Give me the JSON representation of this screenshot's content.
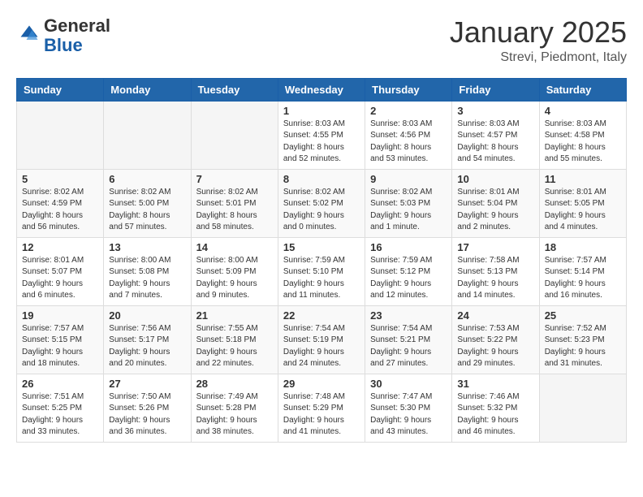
{
  "logo": {
    "general": "General",
    "blue": "Blue"
  },
  "header": {
    "title": "January 2025",
    "subtitle": "Strevi, Piedmont, Italy"
  },
  "weekdays": [
    "Sunday",
    "Monday",
    "Tuesday",
    "Wednesday",
    "Thursday",
    "Friday",
    "Saturday"
  ],
  "weeks": [
    [
      {
        "day": "",
        "info": ""
      },
      {
        "day": "",
        "info": ""
      },
      {
        "day": "",
        "info": ""
      },
      {
        "day": "1",
        "info": "Sunrise: 8:03 AM\nSunset: 4:55 PM\nDaylight: 8 hours and 52 minutes."
      },
      {
        "day": "2",
        "info": "Sunrise: 8:03 AM\nSunset: 4:56 PM\nDaylight: 8 hours and 53 minutes."
      },
      {
        "day": "3",
        "info": "Sunrise: 8:03 AM\nSunset: 4:57 PM\nDaylight: 8 hours and 54 minutes."
      },
      {
        "day": "4",
        "info": "Sunrise: 8:03 AM\nSunset: 4:58 PM\nDaylight: 8 hours and 55 minutes."
      }
    ],
    [
      {
        "day": "5",
        "info": "Sunrise: 8:02 AM\nSunset: 4:59 PM\nDaylight: 8 hours and 56 minutes."
      },
      {
        "day": "6",
        "info": "Sunrise: 8:02 AM\nSunset: 5:00 PM\nDaylight: 8 hours and 57 minutes."
      },
      {
        "day": "7",
        "info": "Sunrise: 8:02 AM\nSunset: 5:01 PM\nDaylight: 8 hours and 58 minutes."
      },
      {
        "day": "8",
        "info": "Sunrise: 8:02 AM\nSunset: 5:02 PM\nDaylight: 9 hours and 0 minutes."
      },
      {
        "day": "9",
        "info": "Sunrise: 8:02 AM\nSunset: 5:03 PM\nDaylight: 9 hours and 1 minute."
      },
      {
        "day": "10",
        "info": "Sunrise: 8:01 AM\nSunset: 5:04 PM\nDaylight: 9 hours and 2 minutes."
      },
      {
        "day": "11",
        "info": "Sunrise: 8:01 AM\nSunset: 5:05 PM\nDaylight: 9 hours and 4 minutes."
      }
    ],
    [
      {
        "day": "12",
        "info": "Sunrise: 8:01 AM\nSunset: 5:07 PM\nDaylight: 9 hours and 6 minutes."
      },
      {
        "day": "13",
        "info": "Sunrise: 8:00 AM\nSunset: 5:08 PM\nDaylight: 9 hours and 7 minutes."
      },
      {
        "day": "14",
        "info": "Sunrise: 8:00 AM\nSunset: 5:09 PM\nDaylight: 9 hours and 9 minutes."
      },
      {
        "day": "15",
        "info": "Sunrise: 7:59 AM\nSunset: 5:10 PM\nDaylight: 9 hours and 11 minutes."
      },
      {
        "day": "16",
        "info": "Sunrise: 7:59 AM\nSunset: 5:12 PM\nDaylight: 9 hours and 12 minutes."
      },
      {
        "day": "17",
        "info": "Sunrise: 7:58 AM\nSunset: 5:13 PM\nDaylight: 9 hours and 14 minutes."
      },
      {
        "day": "18",
        "info": "Sunrise: 7:57 AM\nSunset: 5:14 PM\nDaylight: 9 hours and 16 minutes."
      }
    ],
    [
      {
        "day": "19",
        "info": "Sunrise: 7:57 AM\nSunset: 5:15 PM\nDaylight: 9 hours and 18 minutes."
      },
      {
        "day": "20",
        "info": "Sunrise: 7:56 AM\nSunset: 5:17 PM\nDaylight: 9 hours and 20 minutes."
      },
      {
        "day": "21",
        "info": "Sunrise: 7:55 AM\nSunset: 5:18 PM\nDaylight: 9 hours and 22 minutes."
      },
      {
        "day": "22",
        "info": "Sunrise: 7:54 AM\nSunset: 5:19 PM\nDaylight: 9 hours and 24 minutes."
      },
      {
        "day": "23",
        "info": "Sunrise: 7:54 AM\nSunset: 5:21 PM\nDaylight: 9 hours and 27 minutes."
      },
      {
        "day": "24",
        "info": "Sunrise: 7:53 AM\nSunset: 5:22 PM\nDaylight: 9 hours and 29 minutes."
      },
      {
        "day": "25",
        "info": "Sunrise: 7:52 AM\nSunset: 5:23 PM\nDaylight: 9 hours and 31 minutes."
      }
    ],
    [
      {
        "day": "26",
        "info": "Sunrise: 7:51 AM\nSunset: 5:25 PM\nDaylight: 9 hours and 33 minutes."
      },
      {
        "day": "27",
        "info": "Sunrise: 7:50 AM\nSunset: 5:26 PM\nDaylight: 9 hours and 36 minutes."
      },
      {
        "day": "28",
        "info": "Sunrise: 7:49 AM\nSunset: 5:28 PM\nDaylight: 9 hours and 38 minutes."
      },
      {
        "day": "29",
        "info": "Sunrise: 7:48 AM\nSunset: 5:29 PM\nDaylight: 9 hours and 41 minutes."
      },
      {
        "day": "30",
        "info": "Sunrise: 7:47 AM\nSunset: 5:30 PM\nDaylight: 9 hours and 43 minutes."
      },
      {
        "day": "31",
        "info": "Sunrise: 7:46 AM\nSunset: 5:32 PM\nDaylight: 9 hours and 46 minutes."
      },
      {
        "day": "",
        "info": ""
      }
    ]
  ]
}
